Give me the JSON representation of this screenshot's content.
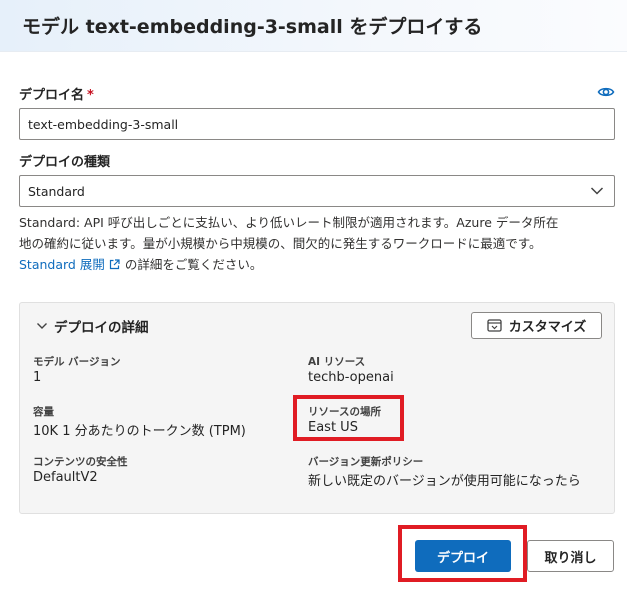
{
  "dialog": {
    "title": "モデル text-embedding-3-small をデプロイする"
  },
  "form": {
    "deployment_name": {
      "label": "デプロイ名",
      "required_mark": "*",
      "value": "text-embedding-3-small",
      "icon": "eye-icon"
    },
    "deployment_type": {
      "label": "デプロイの種類",
      "selected": "Standard",
      "icon": "chevron-down-icon"
    },
    "description": {
      "line1": "Standard: API 呼び出しごとに支払い、より低いレート制限が適用されます。Azure データ所在",
      "line2": "地の確約に従います。量が小規模から中規模の、間欠的に発生するワークロードに最適です。",
      "link_text": "Standard 展開",
      "link_suffix": "の詳細をご覧ください。"
    }
  },
  "details": {
    "title": "デプロイの詳細",
    "customize_label": "カスタマイズ",
    "fields": {
      "model_version": {
        "label": "モデル バージョン",
        "value": "1"
      },
      "ai_resource": {
        "label": "AI リソース",
        "value": "techb-openai"
      },
      "capacity": {
        "label": "容量",
        "value": "10K 1 分あたりのトークン数 (TPM)"
      },
      "resource_location": {
        "label": "リソースの場所",
        "value": "East US"
      },
      "content_safety": {
        "label": "コンテンツの安全性",
        "value": "DefaultV2"
      },
      "version_update_policy": {
        "label": "バージョン更新ポリシー",
        "value": "新しい既定のバージョンが使用可能になったら"
      }
    }
  },
  "actions": {
    "deploy_label": "デプロイ",
    "cancel_label": "取り消し"
  },
  "colors": {
    "primary": "#0f6cbd",
    "highlight": "#e01c24",
    "required": "#c50f1f"
  }
}
